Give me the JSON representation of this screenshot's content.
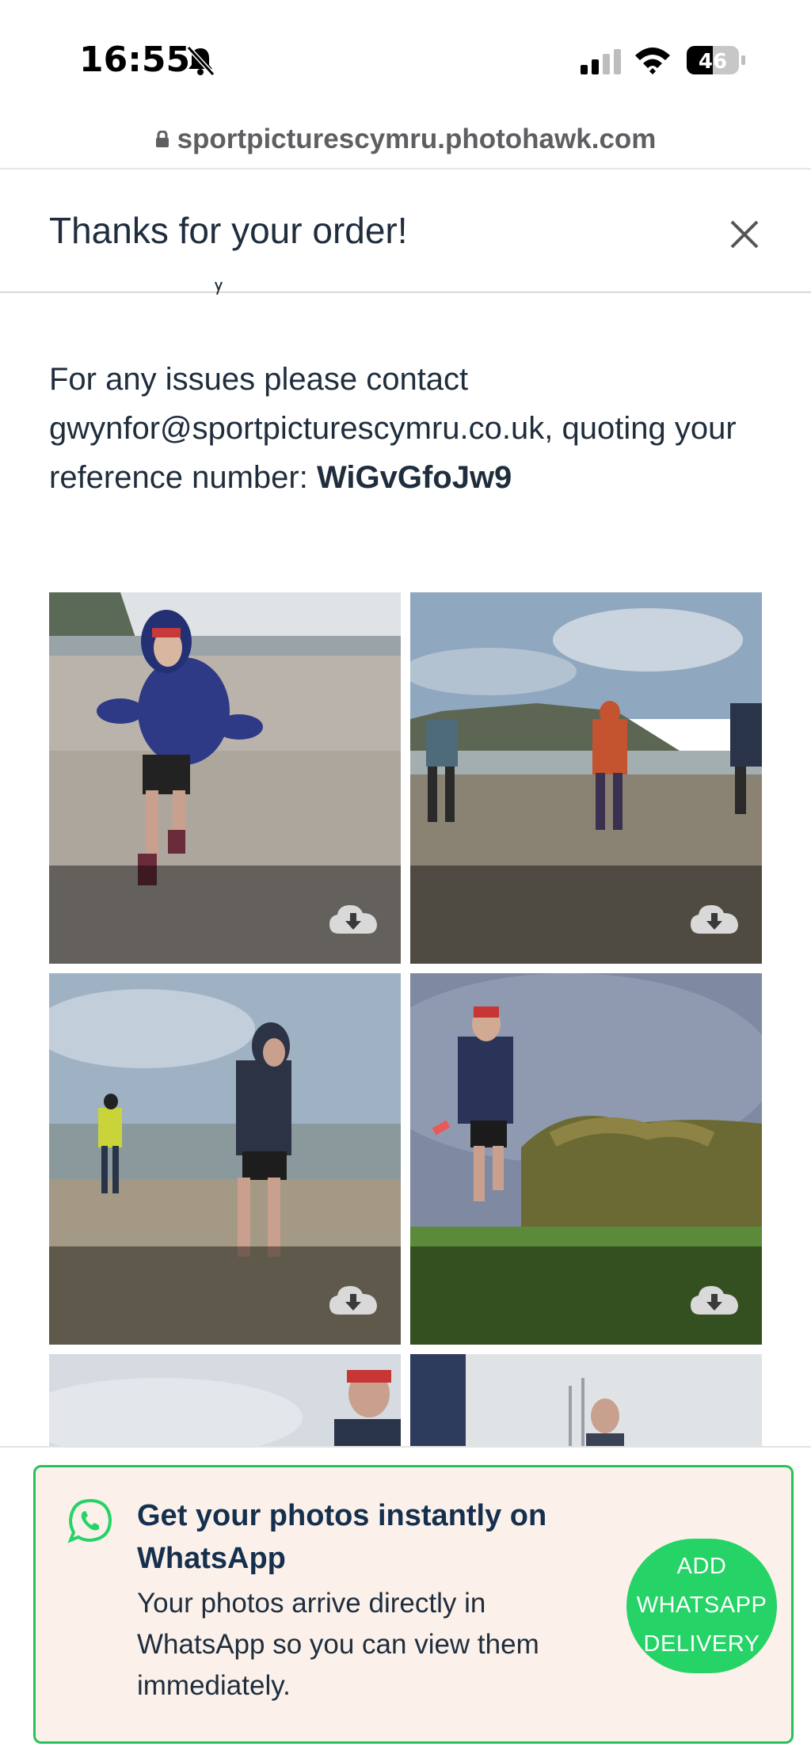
{
  "status_bar": {
    "time": "16:55",
    "battery": "46",
    "url": "sportpicturescymru.photohawk.com"
  },
  "modal": {
    "title": "Thanks for your order!",
    "contact_prefix": "For any issues please contact gwynfor@sportpicturescymru.co.uk, quoting your reference number: ",
    "reference": "WiGvGfoJw9"
  },
  "photos": [
    {
      "description": "runner in blue jacket on beach",
      "action_icon": "download-icon"
    },
    {
      "description": "runners walking on beach with cliffs",
      "action_icon": "download-icon"
    },
    {
      "description": "runner on beach with photographer",
      "action_icon": "download-icon"
    },
    {
      "description": "runner on grassy trail",
      "action_icon": "download-icon"
    },
    {
      "description": "runner in red cap close-up",
      "action_icon": ""
    },
    {
      "description": "runner partially visible",
      "action_icon": ""
    }
  ],
  "whatsapp_banner": {
    "title": "Get your photos instantly on WhatsApp",
    "description": "Your photos arrive directly in WhatsApp so you can view them immediately.",
    "button_line1": "ADD",
    "button_line2": "WHATSAPP",
    "button_line3": "DELIVERY",
    "accent_color": "#25d366"
  }
}
